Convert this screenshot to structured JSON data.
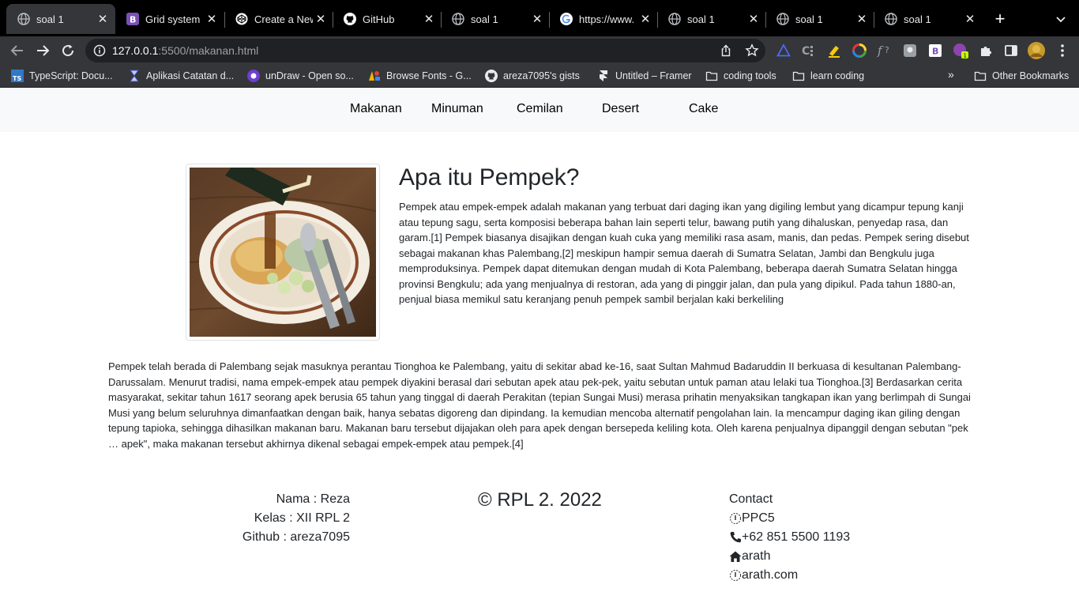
{
  "browser": {
    "tabs": [
      {
        "title": "soal 1",
        "icon": "globe-icon",
        "active": true
      },
      {
        "title": "Grid system",
        "icon": "bootstrap-icon"
      },
      {
        "title": "Create a New",
        "icon": "codepen-icon"
      },
      {
        "title": "GitHub",
        "icon": "github-icon"
      },
      {
        "title": "soal 1",
        "icon": "globe-icon"
      },
      {
        "title": "https://www.",
        "icon": "google-icon"
      },
      {
        "title": "soal 1",
        "icon": "globe-icon"
      },
      {
        "title": "soal 1",
        "icon": "globe-icon"
      },
      {
        "title": "soal 1",
        "icon": "globe-icon"
      }
    ],
    "address": {
      "host": "127.0.0.1",
      "path": ":5500/makanan.html"
    },
    "bookmarks": [
      {
        "label": "TypeScript: Docu...",
        "icon": "typescript-icon"
      },
      {
        "label": "Aplikasi Catatan d...",
        "icon": "hourglass-icon"
      },
      {
        "label": "unDraw - Open so...",
        "icon": "undraw-icon"
      },
      {
        "label": "Browse Fonts - G...",
        "icon": "google-fonts-icon"
      },
      {
        "label": "areza7095's gists",
        "icon": "github-icon"
      },
      {
        "label": "Untitled – Framer",
        "icon": "framer-icon"
      },
      {
        "label": "coding tools",
        "icon": "folder-icon"
      },
      {
        "label": "learn coding",
        "icon": "folder-icon"
      }
    ],
    "other_bookmarks": "Other Bookmarks",
    "more_bookmarks": "»"
  },
  "nav": {
    "items": [
      "Makanan",
      "Minuman",
      "Cemilan",
      "Desert",
      "Cake"
    ]
  },
  "article": {
    "title": "Apa itu Pempek?",
    "lead": "Pempek atau empek-empek adalah makanan yang terbuat dari daging ikan yang digiling lembut yang dicampur tepung kanji atau tepung sagu, serta komposisi beberapa bahan lain seperti telur, bawang putih yang dihaluskan, penyedap rasa, dan garam.[1] Pempek biasanya disajikan dengan kuah cuka yang memiliki rasa asam, manis, dan pedas. Pempek sering disebut sebagai makanan khas Palembang,[2] meskipun hampir semua daerah di Sumatra Selatan, Jambi dan Bengkulu juga memproduksinya. Pempek dapat ditemukan dengan mudah di Kota Palembang, beberapa daerah Sumatra Selatan hingga provinsi Bengkulu; ada yang menjualnya di restoran, ada yang di pinggir jalan, dan pula yang dipikul. Pada tahun 1880-an, penjual biasa memikul satu keranjang penuh pempek sambil berjalan kaki berkeliling",
    "history": "Pempek telah berada di Palembang sejak masuknya perantau Tionghoa ke Palembang, yaitu di sekitar abad ke-16, saat Sultan Mahmud Badaruddin II berkuasa di kesultanan Palembang-Darussalam. Menurut tradisi, nama empek-empek atau pempek diyakini berasal dari sebutan apek atau pek-pek, yaitu sebutan untuk paman atau lelaki tua Tionghoa.[3] Berdasarkan cerita masyarakat, sekitar tahun 1617 seorang apek berusia 65 tahun yang tinggal di daerah Perakitan (tepian Sungai Musi) merasa prihatin menyaksikan tangkapan ikan yang berlimpah di Sungai Musi yang belum seluruhnya dimanfaatkan dengan baik, hanya sebatas digoreng dan dipindang. Ia kemudian mencoba alternatif pengolahan lain. Ia mencampur daging ikan giling dengan tepung tapioka, sehingga dihasilkan makanan baru. Makanan baru tersebut dijajakan oleh para apek dengan bersepeda keliling kota. Oleh karena penjualnya dipanggil dengan sebutan \"pek … apek\", maka makanan tersebut akhirnya dikenal sebagai empek-empek atau pempek.[4]"
  },
  "footer": {
    "name": "Nama : Reza",
    "kelas": "Kelas : XII RPL 2",
    "github": "Github : areza7095",
    "copyright": "© RPL 2. 2022",
    "contact_title": "Contact",
    "contact": [
      {
        "icon": "missing-glyph-icon",
        "text": "PPC5"
      },
      {
        "icon": "phone-icon",
        "text": "+62 851 5500 1193"
      },
      {
        "icon": "home-icon",
        "text": "arath"
      },
      {
        "icon": "missing-glyph-icon",
        "text": "arath.com"
      }
    ]
  }
}
